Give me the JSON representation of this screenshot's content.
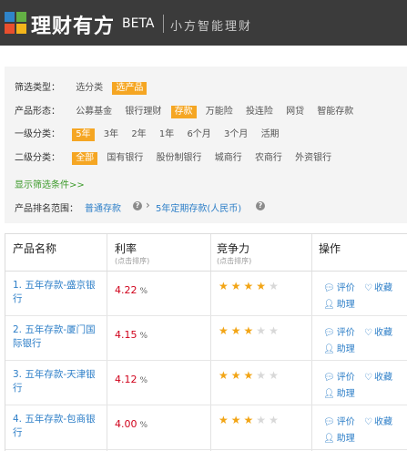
{
  "header": {
    "brand": "理财有方",
    "beta": "BETA",
    "slogan": "小方智能理财"
  },
  "filter": {
    "type_label": "筛选类型：",
    "type_options": [
      "选分类",
      "选产品"
    ],
    "form_label": "产品形态：",
    "form_options": [
      "公募基金",
      "银行理财",
      "存款",
      "万能险",
      "投连险",
      "网贷",
      "智能存款"
    ],
    "level1_label": "一级分类：",
    "level1_options": [
      "5年",
      "3年",
      "2年",
      "1年",
      "6个月",
      "3个月",
      "活期"
    ],
    "level2_label": "二级分类：",
    "level2_options": [
      "全部",
      "国有银行",
      "股份制银行",
      "城商行",
      "农商行",
      "外资银行"
    ],
    "more_link": "显示筛选条件>>",
    "rank_label": "产品排名范围：",
    "rank_path": [
      "普通存款",
      "5年定期存款(人民币)"
    ]
  },
  "table": {
    "headers": {
      "name": "产品名称",
      "rate": "利率",
      "rate_sub": "(点击排序)",
      "comp": "竞争力",
      "comp_sub": "(点击排序)",
      "ops": "操作"
    },
    "rows": [
      {
        "name": "1. 五年存款-盛京银行",
        "rate": "4.22",
        "unit": "%",
        "stars": 4,
        "review": "评价",
        "fav": "收藏",
        "helper": "助理"
      },
      {
        "name": "2. 五年存款-厦门国际银行",
        "rate": "4.15",
        "unit": "%",
        "stars": 3,
        "review": "评价",
        "fav": "收藏",
        "helper": "助理"
      },
      {
        "name": "3. 五年存款-天津银行",
        "rate": "4.12",
        "unit": "%",
        "stars": 3,
        "review": "评价",
        "fav": "收藏",
        "helper": "助理"
      },
      {
        "name": "4. 五年存款-包商银行",
        "rate": "4.00",
        "unit": "%",
        "stars": 3,
        "review": "评价",
        "fav": "收藏",
        "helper": "助理"
      }
    ]
  },
  "colors": {
    "header_bg": "#3b3b3b",
    "accent": "#f5a623",
    "link": "#2e7fc8",
    "rate": "#d0021b",
    "star": "#f2a516"
  }
}
